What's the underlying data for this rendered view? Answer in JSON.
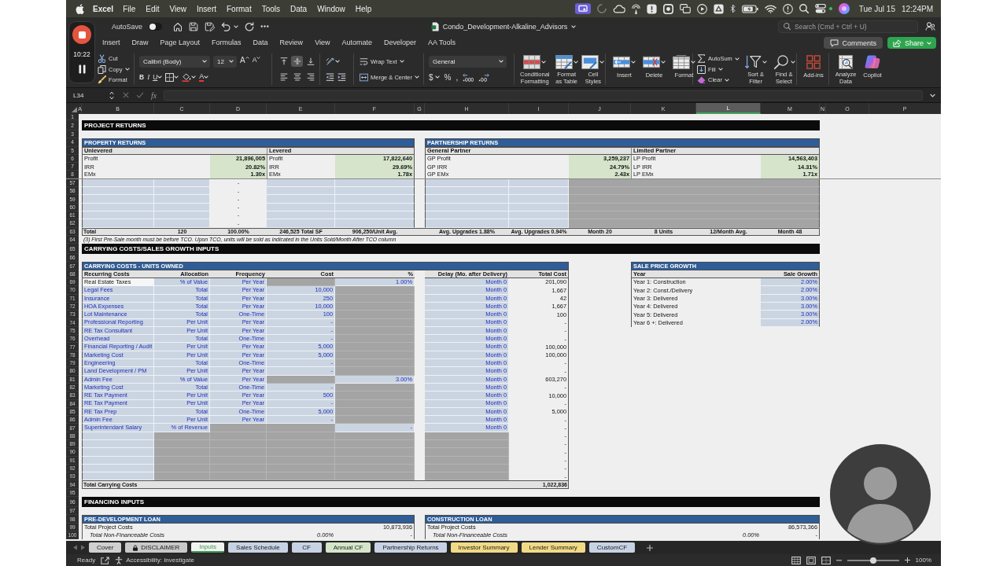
{
  "menu_bar": {
    "app": "Excel",
    "items": [
      "File",
      "Edit",
      "View",
      "Insert",
      "Format",
      "Tools",
      "Data",
      "Window",
      "Help"
    ],
    "date": "Tue Jul 15",
    "time": "12:24PM"
  },
  "recorder": {
    "timer": "10:22"
  },
  "title_bar": {
    "autosave": {
      "label": "AutoSave",
      "on": false
    },
    "document": "Condo_Development-Alkaline_Advisors",
    "search": {
      "placeholder": "Search (Cmd + Ctrl + U)"
    }
  },
  "ribbon_tabs": [
    {
      "label": "Insert",
      "selected": false
    },
    {
      "label": "Draw",
      "selected": false
    },
    {
      "label": "Page Layout",
      "selected": false
    },
    {
      "label": "Formulas",
      "selected": false
    },
    {
      "label": "Data",
      "selected": false
    },
    {
      "label": "Review",
      "selected": false
    },
    {
      "label": "View",
      "selected": false
    },
    {
      "label": "Automate",
      "selected": false
    },
    {
      "label": "Developer",
      "selected": false
    },
    {
      "label": "AA Tools",
      "selected": false
    }
  ],
  "ribbon_actions": {
    "comments": "Comments",
    "share": "Share"
  },
  "ribbon": {
    "clipboard": [
      "Cut",
      "Copy",
      "Format"
    ],
    "font": {
      "name": "Calibri (Body)",
      "size": "12",
      "grow": "A",
      "shrink": "A",
      "styles": [
        "B",
        "I",
        "U"
      ],
      "letter_button": "A"
    },
    "vertical_align": [
      {
        "kind": "top",
        "selected": false
      },
      {
        "kind": "middle",
        "selected": true
      },
      {
        "kind": "bottom",
        "selected": false
      }
    ],
    "horizontal_align": [
      {
        "kind": "left",
        "selected": false
      },
      {
        "kind": "center",
        "selected": false
      },
      {
        "kind": "right",
        "selected": false
      }
    ],
    "wrap_text": "Wrap Text",
    "merge": "Merge & Center",
    "number": {
      "format": "General",
      "symbols": [
        "$",
        "%",
        ","
      ]
    },
    "styles": [
      "Conditional Formatting",
      "Format as Table",
      "Cell Styles"
    ],
    "cells": [
      "Insert",
      "Delete",
      "Format"
    ],
    "editing": [
      "AutoSum",
      "Fill",
      "Clear"
    ],
    "sort_find": [
      "Sort & Filter",
      "Find & Select"
    ],
    "add_ins": "Add-ins",
    "tools": [
      "Analyze Data",
      "Copilot"
    ]
  },
  "formula_bar": {
    "name_box": "L34",
    "function_label": "fx"
  },
  "sheet": {
    "columns": [
      {
        "label": "A",
        "selected": false
      },
      {
        "label": "B",
        "selected": false
      },
      {
        "label": "C",
        "selected": false
      },
      {
        "label": "D",
        "selected": false
      },
      {
        "label": "E",
        "selected": false
      },
      {
        "label": "F",
        "selected": false
      },
      {
        "label": "G",
        "selected": false
      },
      {
        "label": "H",
        "selected": false
      },
      {
        "label": "I",
        "selected": false
      },
      {
        "label": "J",
        "selected": false
      },
      {
        "label": "K",
        "selected": false
      },
      {
        "label": "L",
        "selected": true
      },
      {
        "label": "M",
        "selected": false
      },
      {
        "label": "N",
        "selected": false
      },
      {
        "label": "O",
        "selected": false
      },
      {
        "label": "P",
        "selected": false
      }
    ],
    "rows": [
      {
        "number": "1",
        "kind": "blank"
      },
      {
        "number": "2",
        "kind": "section",
        "title": "PROJECT RETURNS"
      },
      {
        "number": "3",
        "kind": "blank"
      },
      {
        "number": "4",
        "kind": "panel_titles",
        "titles": [
          "PROPERTY RETURNS",
          "PARTNERSHIP RETURNS"
        ]
      },
      {
        "number": "5",
        "kind": "panel_subtitles",
        "titles": [
          "Unlevered",
          "Levered",
          "General Partner",
          "Limited Partner"
        ]
      },
      {
        "number": "6",
        "kind": "metrics",
        "cells": [
          {
            "label": "Profit",
            "value": "21,896,005"
          },
          {
            "label": "Profit",
            "value": "17,822,640"
          },
          {
            "label": "GP Profit",
            "value": "3,259,237"
          },
          {
            "label": "LP Profit",
            "value": "14,563,403"
          }
        ]
      },
      {
        "number": "7",
        "kind": "metrics",
        "cells": [
          {
            "label": "IRR",
            "value": "20.82%"
          },
          {
            "label": "IRR",
            "value": "29.69%"
          },
          {
            "label": "GP IRR",
            "value": "24.79%"
          },
          {
            "label": "LP IRR",
            "value": "14.31%"
          }
        ]
      },
      {
        "number": "8",
        "kind": "metrics",
        "cells": [
          {
            "label": "EMx",
            "value": "1.30x"
          },
          {
            "label": "EMx",
            "value": "1.78x"
          },
          {
            "label": "GP EMx",
            "value": "2.43x"
          },
          {
            "label": "LP EMx",
            "value": "1.71x"
          }
        ]
      },
      {
        "number": "57",
        "kind": "unit_inputs",
        "percent": "-"
      },
      {
        "number": "58",
        "kind": "unit_inputs",
        "percent": "-"
      },
      {
        "number": "59",
        "kind": "unit_inputs",
        "percent": "-"
      },
      {
        "number": "60",
        "kind": "unit_inputs",
        "percent": "-"
      },
      {
        "number": "61",
        "kind": "unit_inputs",
        "percent": "-"
      },
      {
        "number": "62",
        "kind": "unit_inputs",
        "percent": "-"
      },
      {
        "number": "63",
        "kind": "unit_totals",
        "cells": [
          "Total",
          "120",
          "100.00%",
          "246,525 Total SF",
          "906,250/Unit Avg.",
          "Avg. Upgrades 1.88%",
          "Avg. Upgrades 0.94%",
          "Month 20",
          "8 Units",
          "12/Month Avg.",
          "Month 48"
        ]
      },
      {
        "number": "64",
        "kind": "note",
        "text": "(3) First Pre-Sale month must be before TCO. Upon TCO, units will be sold as indicated in the Units Sold/Month After TCO column"
      },
      {
        "number": "65",
        "kind": "section",
        "title": "CARRYING COSTS/SALES GROWTH INPUTS"
      },
      {
        "number": "66",
        "kind": "blank"
      },
      {
        "number": "67",
        "kind": "cost_panel_titles",
        "titles": [
          "CARRYING COSTS - UNITS OWNED",
          "SALE PRICE GROWTH"
        ]
      },
      {
        "number": "68",
        "kind": "cost_headings",
        "cost": [
          "Recurring Costs",
          "Allocation",
          "Frequency",
          "Cost",
          "%",
          "Delay (Mo. after Delivery)",
          "Total Cost"
        ],
        "growth": [
          "Year",
          "Sale Growth"
        ]
      },
      {
        "number": "69",
        "kind": "cost",
        "cost": {
          "name": "Real Estate Taxes",
          "editable": false,
          "allocation": "% of Value",
          "frequency": "Per Year",
          "percent": "1.00%",
          "delay": "Month 0",
          "total": "201,090"
        },
        "growth": {
          "year": "Year 1: Construction",
          "rate": "2.00%"
        }
      },
      {
        "number": "70",
        "kind": "cost",
        "cost": {
          "name": "Legal Fees",
          "editable": true,
          "allocation": "Total",
          "frequency": "Per Year",
          "cost": "10,000",
          "delay": "Month 0",
          "total": "1,667"
        },
        "growth": {
          "year": "Year 2: Const./Delivery",
          "rate": "2.00%"
        }
      },
      {
        "number": "71",
        "kind": "cost",
        "cost": {
          "name": "Insurance",
          "editable": true,
          "allocation": "Total",
          "frequency": "Per Year",
          "cost": "250",
          "delay": "Month 0",
          "total": "42"
        },
        "growth": {
          "year": "Year 3: Delivered",
          "rate": "3.00%"
        }
      },
      {
        "number": "72",
        "kind": "cost",
        "cost": {
          "name": "HOA Expenses",
          "editable": true,
          "allocation": "Total",
          "frequency": "Per Year",
          "cost": "10,000",
          "delay": "Month 0",
          "total": "1,667"
        },
        "growth": {
          "year": "Year 4: Delivered",
          "rate": "3.00%"
        }
      },
      {
        "number": "73",
        "kind": "cost",
        "cost": {
          "name": "Lot Maintenance",
          "editable": true,
          "allocation": "Total",
          "frequency": "One-Time",
          "cost": "100",
          "delay": "Month 0",
          "total": "100"
        },
        "growth": {
          "year": "Year 5: Delivered",
          "rate": "3.00%"
        }
      },
      {
        "number": "74",
        "kind": "cost",
        "cost": {
          "name": "Professional Reporting",
          "editable": true,
          "allocation": "Per Unit",
          "frequency": "Per Year",
          "cost": "-",
          "delay": "Month 0",
          "total": "-"
        },
        "growth": {
          "year": "Year 6 +: Delivered",
          "rate": "2.00%"
        }
      },
      {
        "number": "75",
        "kind": "cost",
        "cost": {
          "name": "RE Tax Consultant",
          "editable": true,
          "allocation": "Per Unit",
          "frequency": "Per Year",
          "cost": "-",
          "delay": "Month 0",
          "total": "-"
        }
      },
      {
        "number": "76",
        "kind": "cost",
        "cost": {
          "name": "Overhead",
          "editable": true,
          "allocation": "Total",
          "frequency": "One-Time",
          "cost": "-",
          "delay": "Month 0",
          "total": "-"
        }
      },
      {
        "number": "77",
        "kind": "cost",
        "cost": {
          "name": "Financial Reporting / Audit",
          "editable": true,
          "allocation": "Per Unit",
          "frequency": "Per Year",
          "cost": "5,000",
          "delay": "Month 0",
          "total": "100,000"
        }
      },
      {
        "number": "78",
        "kind": "cost",
        "cost": {
          "name": "Marketing Cost",
          "editable": true,
          "allocation": "Per Unit",
          "frequency": "Per Year",
          "cost": "5,000",
          "delay": "Month 0",
          "total": "100,000"
        }
      },
      {
        "number": "79",
        "kind": "cost",
        "cost": {
          "name": "Engineering",
          "editable": true,
          "allocation": "Total",
          "frequency": "One-Time",
          "cost": "-",
          "delay": "Month 0",
          "total": "-"
        }
      },
      {
        "number": "80",
        "kind": "cost",
        "cost": {
          "name": "Land Development / PM",
          "editable": true,
          "allocation": "Per Unit",
          "frequency": "Per Year",
          "cost": "-",
          "delay": "Month 0",
          "total": "-"
        }
      },
      {
        "number": "81",
        "kind": "cost",
        "cost": {
          "name": "Admin Fee",
          "editable": true,
          "allocation": "% of Value",
          "frequency": "Per Year",
          "percent": "3.00%",
          "delay": "Month 0",
          "total": "603,270"
        }
      },
      {
        "number": "82",
        "kind": "cost",
        "cost": {
          "name": "Marketing Cost",
          "editable": true,
          "allocation": "Total",
          "frequency": "One-Time",
          "cost": "-",
          "delay": "Month 0",
          "total": "-"
        }
      },
      {
        "number": "83",
        "kind": "cost",
        "cost": {
          "name": "RE Tax Payment",
          "editable": true,
          "allocation": "Per Unit",
          "frequency": "Per Year",
          "cost": "500",
          "delay": "Month 0",
          "total": "10,000"
        }
      },
      {
        "number": "84",
        "kind": "cost",
        "cost": {
          "name": "RE Tax Payment",
          "editable": true,
          "allocation": "Per Unit",
          "frequency": "Per Year",
          "cost": "-",
          "delay": "Month 0",
          "total": "-"
        }
      },
      {
        "number": "85",
        "kind": "cost",
        "cost": {
          "name": "RE Tax Prep",
          "editable": true,
          "allocation": "Total",
          "frequency": "One-Time",
          "cost": "5,000",
          "delay": "Month 0",
          "total": "5,000"
        }
      },
      {
        "number": "86",
        "kind": "cost",
        "cost": {
          "name": "Admin Fee",
          "editable": true,
          "allocation": "Per Unit",
          "frequency": "Per Year",
          "cost": "-",
          "delay": "Month 0",
          "total": "-"
        }
      },
      {
        "number": "87",
        "kind": "cost",
        "cost": {
          "name": "Superintendant Salary",
          "editable": true,
          "allocation": "% of Revenue",
          "percent": "-",
          "delay": "Month 0",
          "total": "-"
        }
      },
      {
        "number": "88",
        "kind": "cost",
        "cost": {
          "editable": true,
          "total": "-"
        }
      },
      {
        "number": "89",
        "kind": "cost",
        "cost": {
          "editable": true,
          "total": "-"
        }
      },
      {
        "number": "90",
        "kind": "cost",
        "cost": {
          "editable": true,
          "total": "-"
        }
      },
      {
        "number": "91",
        "kind": "cost",
        "cost": {
          "editable": true,
          "total": "-"
        }
      },
      {
        "number": "92",
        "kind": "cost",
        "cost": {
          "editable": true,
          "total": "-"
        }
      },
      {
        "number": "93",
        "kind": "cost",
        "cost": {
          "editable": true,
          "total": "-"
        }
      },
      {
        "number": "94",
        "kind": "cost_total",
        "label": "Total Carrying Costs",
        "total": "1,022,836"
      },
      {
        "number": "95",
        "kind": "blank"
      },
      {
        "number": "96",
        "kind": "section",
        "title": "FINANCING INPUTS"
      },
      {
        "number": "97",
        "kind": "blank"
      },
      {
        "number": "98",
        "kind": "panel_titles",
        "titles": [
          "PRE-DEVELOPMENT LOAN",
          "CONSTRUCTION LOAN"
        ]
      },
      {
        "number": "99",
        "kind": "loan",
        "cells": [
          {
            "label": "Total Project Costs",
            "value": "10,873,936"
          },
          {
            "label": "Total Project Costs",
            "value": "86,573,366"
          }
        ]
      },
      {
        "number": "100",
        "kind": "loan_detail",
        "cells": [
          {
            "label": "Total Non-Financeable Costs",
            "percent": "0.00%",
            "value": "-"
          },
          {
            "label": "Total Non-Financeable Costs",
            "percent": "0.00%",
            "value": "-"
          }
        ]
      }
    ]
  },
  "sheet_tabs": [
    {
      "label": "Cover",
      "color": "#cfcfcf",
      "selected": false,
      "locked": false
    },
    {
      "label": "DISCLAIMER",
      "color": "#c9c9c9",
      "selected": false,
      "locked": true
    },
    {
      "label": "Inputs",
      "color": "#3f9b50",
      "selected": true,
      "locked": false
    },
    {
      "label": "Sales Schedule",
      "color": "#c7d3e4",
      "selected": false,
      "locked": false
    },
    {
      "label": "CF",
      "color": "#c7d3e4",
      "selected": false,
      "locked": false
    },
    {
      "label": "Annual CF",
      "color": "#d4e6c9",
      "selected": false,
      "locked": false
    },
    {
      "label": "Partnership Returns",
      "color": "#c7d3e4",
      "selected": false,
      "locked": false
    },
    {
      "label": "Investor Summary",
      "color": "#f1da86",
      "selected": false,
      "locked": false
    },
    {
      "label": "Lender Summary",
      "color": "#f1da86",
      "selected": false,
      "locked": false
    },
    {
      "label": "CustomCF",
      "color": "#c7d3e4",
      "selected": false,
      "locked": false
    }
  ],
  "status_bar": {
    "mode": "Ready",
    "accessibility": "Accessibility: Investigate",
    "zoom": {
      "level": 0.5,
      "reading": "100%"
    }
  }
}
